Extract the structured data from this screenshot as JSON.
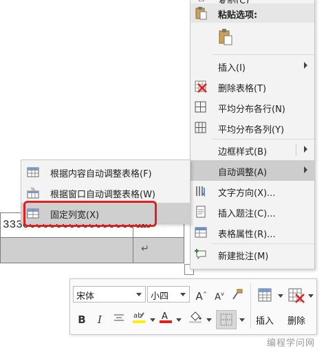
{
  "document": {
    "row1_text": "333ccccccccccccccccccc",
    "row1_tail": "66",
    "return_mark": "↵"
  },
  "context_menu": {
    "top_item": "复制(C)",
    "paste_header": "粘贴选项:",
    "items": [
      {
        "label": "插入(I)",
        "icon": "insert-icon",
        "submenu": true
      },
      {
        "label": "删除表格(T)",
        "icon": "delete-table-icon",
        "submenu": false
      },
      {
        "label": "平均分布各行(N)",
        "icon": "distribute-rows-icon",
        "submenu": false
      },
      {
        "label": "平均分布各列(Y)",
        "icon": "distribute-columns-icon",
        "submenu": false
      },
      {
        "label": "边框样式(B)",
        "icon": "border-style-icon",
        "submenu": true
      },
      {
        "label": "自动调整(A)",
        "icon": "autofit-icon",
        "submenu": true
      },
      {
        "label": "文字方向(X)...",
        "icon": "text-direction-icon",
        "submenu": false
      },
      {
        "label": "插入题注(C)...",
        "icon": "insert-caption-icon",
        "submenu": false
      },
      {
        "label": "表格属性(R)...",
        "icon": "table-properties-icon",
        "submenu": false
      },
      {
        "label": "新建批注(M)",
        "icon": "new-comment-icon",
        "submenu": false
      }
    ]
  },
  "autofit_submenu": {
    "items": [
      {
        "label": "根据内容自动调整表格(F)",
        "icon": "autofit-contents-icon"
      },
      {
        "label": "根据窗口自动调整表格(W)",
        "icon": "autofit-window-icon"
      },
      {
        "label": "固定列宽(X)",
        "icon": "fixed-column-width-icon"
      }
    ],
    "highlighted_index": 2
  },
  "mini_toolbar": {
    "font_name": "宋体",
    "font_size": "小四",
    "grow_font": "A",
    "shrink_font": "A",
    "bold": "B",
    "italic": "I",
    "insert_label": "插入",
    "delete_label": "删除",
    "highlight_color": "#ffee00",
    "font_color": "#e02020"
  },
  "watermark": "编程学问网"
}
